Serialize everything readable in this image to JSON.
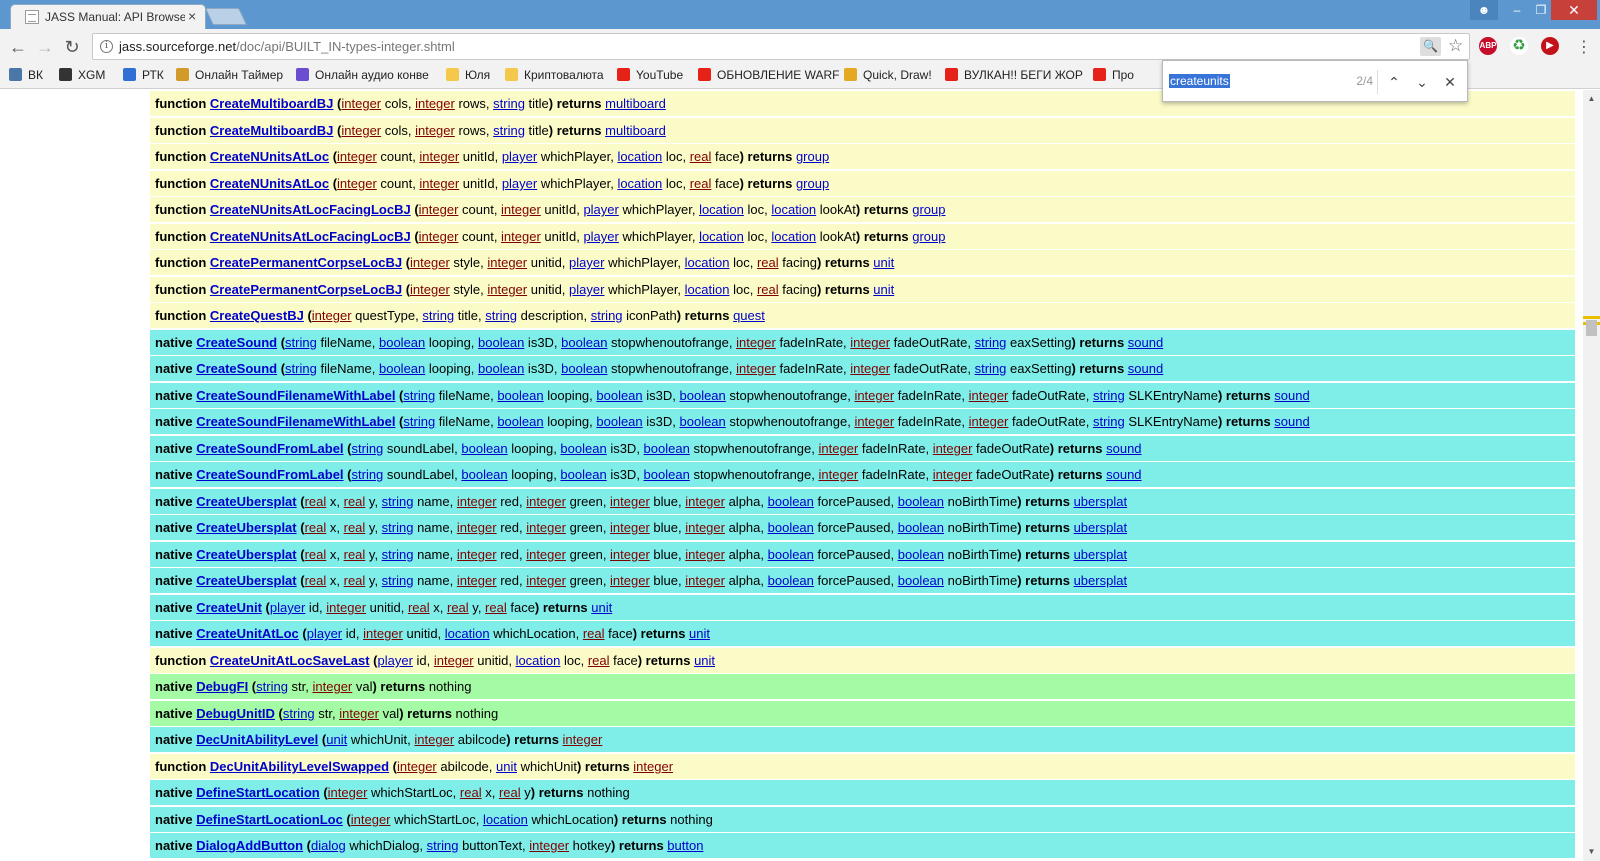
{
  "window": {
    "tab_title": "JASS Manual: API Browse",
    "tab_close": "×",
    "controls": {
      "minimize": "–",
      "maximize": "❐",
      "close": "✕"
    }
  },
  "toolbar": {
    "url_domain": "jass.sourceforge.net",
    "url_path": "/doc/api/BUILT_IN-types-integer.shtml",
    "abp_badge": "ABP",
    "ext_badge": "0"
  },
  "bookmarks": [
    {
      "label": "ВК",
      "color": "#4a76a8"
    },
    {
      "label": "XGM",
      "color": "#333333"
    },
    {
      "label": "РТК",
      "color": "#2f6fd6"
    },
    {
      "label": "Онлайн Таймер",
      "color": "#d39a2a"
    },
    {
      "label": "Онлайн аудио конве",
      "color": "#6b4dd1"
    },
    {
      "label": "Юля",
      "color": "#f3c84b"
    },
    {
      "label": "Криптовалюта",
      "color": "#f3c84b"
    },
    {
      "label": "YouTube",
      "color": "#e62117"
    },
    {
      "label": "ОБНОВЛЕНИЕ WARF",
      "color": "#e62117"
    },
    {
      "label": "Quick, Draw!",
      "color": "#e5a823"
    },
    {
      "label": "ВУЛКАН!! БЕГИ ЖОР",
      "color": "#e62117"
    },
    {
      "label": "Про",
      "color": "#e62117"
    }
  ],
  "findbar": {
    "query": "createunits",
    "count": "2/4"
  },
  "rows": [
    {
      "kind": "function",
      "name": "CreateMultiboardBJ",
      "hl": "",
      "params": [
        [
          "integer",
          "cols"
        ],
        [
          "integer",
          "rows"
        ],
        [
          "string",
          "title"
        ]
      ],
      "ret": "multiboard"
    },
    {
      "kind": "function",
      "name": "CreateMultiboardBJ",
      "hl": "",
      "params": [
        [
          "integer",
          "cols"
        ],
        [
          "integer",
          "rows"
        ],
        [
          "string",
          "title"
        ]
      ],
      "ret": "multiboard"
    },
    {
      "kind": "function",
      "name": "CreateNUnitsAtLoc",
      "hl": "hl",
      "params": [
        [
          "integer",
          "count"
        ],
        [
          "integer",
          "unitId"
        ],
        [
          "player",
          "whichPlayer"
        ],
        [
          "location",
          "loc"
        ],
        [
          "real",
          "face"
        ]
      ],
      "ret": "group"
    },
    {
      "kind": "function",
      "name": "CreateNUnitsAtLoc",
      "hl": "hl-cur",
      "params": [
        [
          "integer",
          "count"
        ],
        [
          "integer",
          "unitId"
        ],
        [
          "player",
          "whichPlayer"
        ],
        [
          "location",
          "loc"
        ],
        [
          "real",
          "face"
        ]
      ],
      "ret": "group"
    },
    {
      "kind": "function",
      "name": "CreateNUnitsAtLocFacingLocBJ",
      "hl": "hl",
      "params": [
        [
          "integer",
          "count"
        ],
        [
          "integer",
          "unitId"
        ],
        [
          "player",
          "whichPlayer"
        ],
        [
          "location",
          "loc"
        ],
        [
          "location",
          "lookAt"
        ]
      ],
      "ret": "group"
    },
    {
      "kind": "function",
      "name": "CreateNUnitsAtLocFacingLocBJ",
      "hl": "hl",
      "params": [
        [
          "integer",
          "count"
        ],
        [
          "integer",
          "unitId"
        ],
        [
          "player",
          "whichPlayer"
        ],
        [
          "location",
          "loc"
        ],
        [
          "location",
          "lookAt"
        ]
      ],
      "ret": "group"
    },
    {
      "kind": "function",
      "name": "CreatePermanentCorpseLocBJ",
      "hl": "",
      "params": [
        [
          "integer",
          "style"
        ],
        [
          "integer",
          "unitid"
        ],
        [
          "player",
          "whichPlayer"
        ],
        [
          "location",
          "loc"
        ],
        [
          "real",
          "facing"
        ]
      ],
      "ret": "unit"
    },
    {
      "kind": "function",
      "name": "CreatePermanentCorpseLocBJ",
      "hl": "",
      "params": [
        [
          "integer",
          "style"
        ],
        [
          "integer",
          "unitid"
        ],
        [
          "player",
          "whichPlayer"
        ],
        [
          "location",
          "loc"
        ],
        [
          "real",
          "facing"
        ]
      ],
      "ret": "unit"
    },
    {
      "kind": "function",
      "name": "CreateQuestBJ",
      "hl": "",
      "params": [
        [
          "integer",
          "questType"
        ],
        [
          "string",
          "title"
        ],
        [
          "string",
          "description"
        ],
        [
          "string",
          "iconPath"
        ]
      ],
      "ret": "quest"
    },
    {
      "kind": "native",
      "name": "CreateSound",
      "hl": "",
      "params": [
        [
          "string",
          "fileName"
        ],
        [
          "boolean",
          "looping"
        ],
        [
          "boolean",
          "is3D"
        ],
        [
          "boolean",
          "stopwhenoutofrange"
        ],
        [
          "integer",
          "fadeInRate"
        ],
        [
          "integer",
          "fadeOutRate"
        ],
        [
          "string",
          "eaxSetting"
        ]
      ],
      "ret": "sound"
    },
    {
      "kind": "native",
      "name": "CreateSound",
      "hl": "",
      "params": [
        [
          "string",
          "fileName"
        ],
        [
          "boolean",
          "looping"
        ],
        [
          "boolean",
          "is3D"
        ],
        [
          "boolean",
          "stopwhenoutofrange"
        ],
        [
          "integer",
          "fadeInRate"
        ],
        [
          "integer",
          "fadeOutRate"
        ],
        [
          "string",
          "eaxSetting"
        ]
      ],
      "ret": "sound"
    },
    {
      "kind": "native",
      "name": "CreateSoundFilenameWithLabel",
      "hl": "",
      "params": [
        [
          "string",
          "fileName"
        ],
        [
          "boolean",
          "looping"
        ],
        [
          "boolean",
          "is3D"
        ],
        [
          "boolean",
          "stopwhenoutofrange"
        ],
        [
          "integer",
          "fadeInRate"
        ],
        [
          "integer",
          "fadeOutRate"
        ],
        [
          "string",
          "SLKEntryName"
        ]
      ],
      "ret": "sound"
    },
    {
      "kind": "native",
      "name": "CreateSoundFilenameWithLabel",
      "hl": "",
      "params": [
        [
          "string",
          "fileName"
        ],
        [
          "boolean",
          "looping"
        ],
        [
          "boolean",
          "is3D"
        ],
        [
          "boolean",
          "stopwhenoutofrange"
        ],
        [
          "integer",
          "fadeInRate"
        ],
        [
          "integer",
          "fadeOutRate"
        ],
        [
          "string",
          "SLKEntryName"
        ]
      ],
      "ret": "sound"
    },
    {
      "kind": "native",
      "name": "CreateSoundFromLabel",
      "hl": "",
      "params": [
        [
          "string",
          "soundLabel"
        ],
        [
          "boolean",
          "looping"
        ],
        [
          "boolean",
          "is3D"
        ],
        [
          "boolean",
          "stopwhenoutofrange"
        ],
        [
          "integer",
          "fadeInRate"
        ],
        [
          "integer",
          "fadeOutRate"
        ]
      ],
      "ret": "sound"
    },
    {
      "kind": "native",
      "name": "CreateSoundFromLabel",
      "hl": "",
      "params": [
        [
          "string",
          "soundLabel"
        ],
        [
          "boolean",
          "looping"
        ],
        [
          "boolean",
          "is3D"
        ],
        [
          "boolean",
          "stopwhenoutofrange"
        ],
        [
          "integer",
          "fadeInRate"
        ],
        [
          "integer",
          "fadeOutRate"
        ]
      ],
      "ret": "sound"
    },
    {
      "kind": "native",
      "name": "CreateUbersplat",
      "hl": "",
      "params": [
        [
          "real",
          "x"
        ],
        [
          "real",
          "y"
        ],
        [
          "string",
          "name"
        ],
        [
          "integer",
          "red"
        ],
        [
          "integer",
          "green"
        ],
        [
          "integer",
          "blue"
        ],
        [
          "integer",
          "alpha"
        ],
        [
          "boolean",
          "forcePaused"
        ],
        [
          "boolean",
          "noBirthTime"
        ]
      ],
      "ret": "ubersplat"
    },
    {
      "kind": "native",
      "name": "CreateUbersplat",
      "hl": "",
      "params": [
        [
          "real",
          "x"
        ],
        [
          "real",
          "y"
        ],
        [
          "string",
          "name"
        ],
        [
          "integer",
          "red"
        ],
        [
          "integer",
          "green"
        ],
        [
          "integer",
          "blue"
        ],
        [
          "integer",
          "alpha"
        ],
        [
          "boolean",
          "forcePaused"
        ],
        [
          "boolean",
          "noBirthTime"
        ]
      ],
      "ret": "ubersplat"
    },
    {
      "kind": "native",
      "name": "CreateUbersplat",
      "hl": "",
      "params": [
        [
          "real",
          "x"
        ],
        [
          "real",
          "y"
        ],
        [
          "string",
          "name"
        ],
        [
          "integer",
          "red"
        ],
        [
          "integer",
          "green"
        ],
        [
          "integer",
          "blue"
        ],
        [
          "integer",
          "alpha"
        ],
        [
          "boolean",
          "forcePaused"
        ],
        [
          "boolean",
          "noBirthTime"
        ]
      ],
      "ret": "ubersplat"
    },
    {
      "kind": "native",
      "name": "CreateUbersplat",
      "hl": "",
      "params": [
        [
          "real",
          "x"
        ],
        [
          "real",
          "y"
        ],
        [
          "string",
          "name"
        ],
        [
          "integer",
          "red"
        ],
        [
          "integer",
          "green"
        ],
        [
          "integer",
          "blue"
        ],
        [
          "integer",
          "alpha"
        ],
        [
          "boolean",
          "forcePaused"
        ],
        [
          "boolean",
          "noBirthTime"
        ]
      ],
      "ret": "ubersplat"
    },
    {
      "kind": "native",
      "name": "CreateUnit",
      "hl": "",
      "params": [
        [
          "player",
          "id"
        ],
        [
          "integer",
          "unitid"
        ],
        [
          "real",
          "x"
        ],
        [
          "real",
          "y"
        ],
        [
          "real",
          "face"
        ]
      ],
      "ret": "unit"
    },
    {
      "kind": "native",
      "name": "CreateUnitAtLoc",
      "hl": "",
      "params": [
        [
          "player",
          "id"
        ],
        [
          "integer",
          "unitid"
        ],
        [
          "location",
          "whichLocation"
        ],
        [
          "real",
          "face"
        ]
      ],
      "ret": "unit"
    },
    {
      "kind": "function",
      "name": "CreateUnitAtLocSaveLast",
      "hl": "",
      "params": [
        [
          "player",
          "id"
        ],
        [
          "integer",
          "unitid"
        ],
        [
          "location",
          "loc"
        ],
        [
          "real",
          "face"
        ]
      ],
      "ret": "unit"
    },
    {
      "kind": "nativeg",
      "name": "DebugFI",
      "hl": "",
      "params": [
        [
          "string",
          "str"
        ],
        [
          "integer",
          "val"
        ]
      ],
      "ret": "nothing"
    },
    {
      "kind": "nativeg",
      "name": "DebugUnitID",
      "hl": "",
      "params": [
        [
          "string",
          "str"
        ],
        [
          "integer",
          "val"
        ]
      ],
      "ret": "nothing"
    },
    {
      "kind": "native",
      "name": "DecUnitAbilityLevel",
      "hl": "",
      "params": [
        [
          "unit",
          "whichUnit"
        ],
        [
          "integer",
          "abilcode"
        ]
      ],
      "ret": "integer"
    },
    {
      "kind": "function",
      "name": "DecUnitAbilityLevelSwapped",
      "hl": "",
      "params": [
        [
          "integer",
          "abilcode"
        ],
        [
          "unit",
          "whichUnit"
        ]
      ],
      "ret": "integer"
    },
    {
      "kind": "native",
      "name": "DefineStartLocation",
      "hl": "",
      "params": [
        [
          "integer",
          "whichStartLoc"
        ],
        [
          "real",
          "x"
        ],
        [
          "real",
          "y"
        ]
      ],
      "ret": "nothing"
    },
    {
      "kind": "native",
      "name": "DefineStartLocationLoc",
      "hl": "",
      "params": [
        [
          "integer",
          "whichStartLoc"
        ],
        [
          "location",
          "whichLocation"
        ]
      ],
      "ret": "nothing"
    },
    {
      "kind": "native",
      "name": "DialogAddButton",
      "hl": "",
      "params": [
        [
          "dialog",
          "whichDialog"
        ],
        [
          "string",
          "buttonText"
        ],
        [
          "integer",
          "hotkey"
        ]
      ],
      "ret": "button"
    }
  ]
}
